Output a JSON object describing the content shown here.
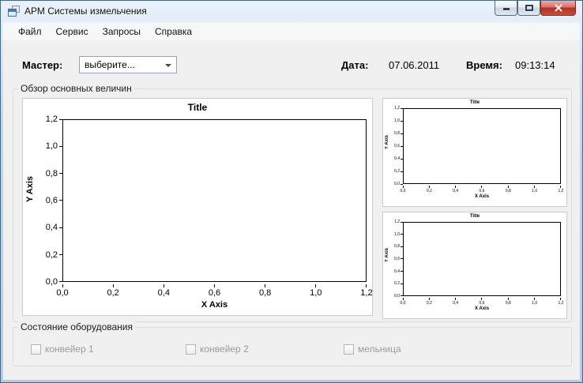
{
  "window": {
    "title": "АРМ Системы измельчения",
    "controls": {
      "minimize": "minimize",
      "maximize": "maximize",
      "close": "close"
    }
  },
  "menu": {
    "items": [
      {
        "label": "Файл"
      },
      {
        "label": "Сервис"
      },
      {
        "label": "Запросы"
      },
      {
        "label": "Справка"
      }
    ]
  },
  "master_bar": {
    "master_label": "Мастер:",
    "master_select_value": "выберите...",
    "date_label": "Дата:",
    "date_value": "07.06.2011",
    "time_label": "Время:",
    "time_value": "09:13:14"
  },
  "groups": {
    "overview": {
      "title": "Обзор основных величин"
    },
    "status": {
      "title": "Состояние оборудования",
      "checkboxes": [
        {
          "label": "конвейер 1",
          "checked": false,
          "enabled": false
        },
        {
          "label": "конвейер 2",
          "checked": false,
          "enabled": false
        },
        {
          "label": "мельница",
          "checked": false,
          "enabled": false
        }
      ]
    }
  },
  "chart_data": [
    {
      "id": "main-chart",
      "type": "line",
      "title": "Title",
      "xlabel": "X Axis",
      "ylabel": "Y Axis",
      "xlim": [
        0.0,
        1.2
      ],
      "ylim": [
        0.0,
        1.2
      ],
      "x_ticks": [
        "0,0",
        "0,2",
        "0,4",
        "0,6",
        "0,8",
        "1,0",
        "1,2"
      ],
      "y_ticks": [
        "1,2",
        "1,0",
        "0,8",
        "0,6",
        "0,4",
        "0,2",
        "0,0"
      ],
      "grid": false,
      "legend": false,
      "series": []
    },
    {
      "id": "small-chart-top",
      "type": "line",
      "title": "Title",
      "xlabel": "X Axis",
      "ylabel": "Y Axis",
      "xlim": [
        0.0,
        1.2
      ],
      "ylim": [
        0.0,
        1.2
      ],
      "x_ticks": [
        "0,0",
        "0,2",
        "0,4",
        "0,6",
        "0,8",
        "1,0",
        "1,2"
      ],
      "y_ticks": [
        "1,2",
        "1,0",
        "0,8",
        "0,6",
        "0,4",
        "0,2",
        "0,0"
      ],
      "grid": false,
      "legend": false,
      "series": []
    },
    {
      "id": "small-chart-bottom",
      "type": "line",
      "title": "Title",
      "xlabel": "X Axis",
      "ylabel": "Y Axis",
      "xlim": [
        0.0,
        1.2
      ],
      "ylim": [
        0.0,
        1.2
      ],
      "x_ticks": [
        "0,0",
        "0,2",
        "0,4",
        "0,6",
        "0,8",
        "1,0",
        "1,2"
      ],
      "y_ticks": [
        "1,2",
        "1,0",
        "0,8",
        "0,6",
        "0,4",
        "0,2",
        "0,0"
      ],
      "grid": false,
      "legend": false,
      "series": []
    }
  ],
  "colors": {
    "frame": "#b2cbe7",
    "client_bg": "#f0f0f0",
    "close_button": "#c0392b",
    "disabled_text": "#9b9b9b"
  }
}
